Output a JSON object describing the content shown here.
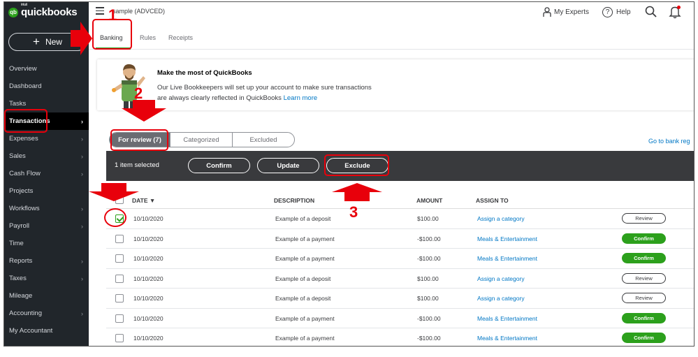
{
  "app": {
    "brand_small": "intuit",
    "brand": "quickbooks",
    "company": "sample (ADVCED)",
    "new_label": "New"
  },
  "sidebar": {
    "items": [
      {
        "label": "Overview",
        "chev": false
      },
      {
        "label": "Dashboard",
        "chev": false
      },
      {
        "label": "Tasks",
        "chev": false
      },
      {
        "label": "Transactions",
        "chev": true,
        "active": true
      },
      {
        "label": "Expenses",
        "chev": true
      },
      {
        "label": "Sales",
        "chev": true
      },
      {
        "label": "Cash Flow",
        "chev": true
      },
      {
        "label": "Projects",
        "chev": false
      },
      {
        "label": "Workflows",
        "chev": true
      },
      {
        "label": "Payroll",
        "chev": true
      },
      {
        "label": "Time",
        "chev": false
      },
      {
        "label": "Reports",
        "chev": true
      },
      {
        "label": "Taxes",
        "chev": true
      },
      {
        "label": "Mileage",
        "chev": false
      },
      {
        "label": "Accounting",
        "chev": true
      },
      {
        "label": "My Accountant",
        "chev": false
      }
    ]
  },
  "topbar": {
    "experts_label": "My Experts",
    "help_label": "Help",
    "help_glyph": "?"
  },
  "tabs": [
    {
      "label": "Banking",
      "active": true
    },
    {
      "label": "Rules"
    },
    {
      "label": "Receipts"
    }
  ],
  "banner": {
    "title": "Make the most of QuickBooks",
    "line1": "Our Live Bookkeepers will set up your account to make sure transactions",
    "line2": "are always clearly reflected in QuickBooks",
    "link": "Learn more"
  },
  "filters": {
    "for_review": "For review (7)",
    "categorized": "Categorized",
    "excluded": "Excluded",
    "go_to_bank": "Go to bank reg"
  },
  "action_bar": {
    "selected_text": "1 item selected",
    "confirm": "Confirm",
    "update": "Update",
    "exclude": "Exclude"
  },
  "table": {
    "headers": {
      "date": "DATE ▼",
      "description": "DESCRIPTION",
      "amount": "AMOUNT",
      "assign": "ASSIGN TO"
    },
    "rows": [
      {
        "checked": true,
        "date": "10/10/2020",
        "description": "Example of a deposit",
        "amount": "$100.00",
        "assign": "Assign a category",
        "action": "Review"
      },
      {
        "checked": false,
        "date": "10/10/2020",
        "description": "Example of a payment",
        "amount": "-$100.00",
        "assign": "Meals & Entertainment",
        "action": "Confirm"
      },
      {
        "checked": false,
        "date": "10/10/2020",
        "description": "Example of a payment",
        "amount": "-$100.00",
        "assign": "Meals & Entertainment",
        "action": "Confirm"
      },
      {
        "checked": false,
        "date": "10/10/2020",
        "description": "Example of a deposit",
        "amount": "$100.00",
        "assign": "Assign a category",
        "action": "Review"
      },
      {
        "checked": false,
        "date": "10/10/2020",
        "description": "Example of a deposit",
        "amount": "$100.00",
        "assign": "Assign a category",
        "action": "Review"
      },
      {
        "checked": false,
        "date": "10/10/2020",
        "description": "Example of a payment",
        "amount": "-$100.00",
        "assign": "Meals & Entertainment",
        "action": "Confirm"
      },
      {
        "checked": false,
        "date": "10/10/2020",
        "description": "Example of a payment",
        "amount": "-$100.00",
        "assign": "Meals & Entertainment",
        "action": "Confirm"
      }
    ]
  },
  "annotations": {
    "step1": "1",
    "step2": "2",
    "step3": "3"
  },
  "colors": {
    "accent_green": "#2ca01c",
    "sidebar_bg": "#21262b",
    "link_blue": "#0077c5",
    "annotation_red": "#e8000b"
  }
}
